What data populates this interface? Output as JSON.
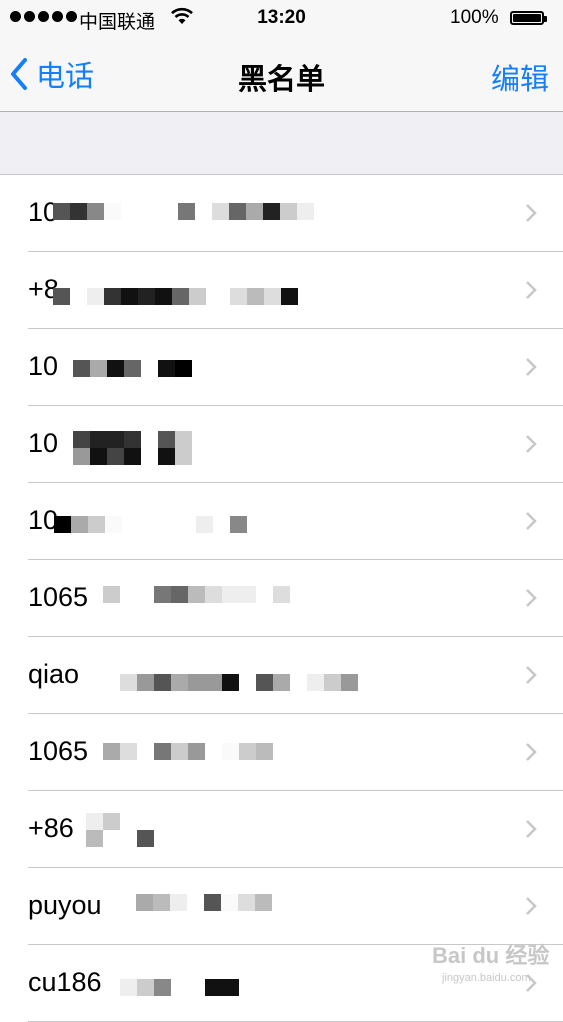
{
  "status_bar": {
    "carrier": "中国联通",
    "time": "13:20",
    "battery": "100%"
  },
  "nav": {
    "back_label": "电话",
    "title": "黑名单",
    "edit_label": "编辑"
  },
  "entries": [
    {
      "text": "10"
    },
    {
      "text": "+8"
    },
    {
      "text": "10"
    },
    {
      "text": "10"
    },
    {
      "text": "10"
    },
    {
      "text": "1065"
    },
    {
      "text": "qiao"
    },
    {
      "text": "1065"
    },
    {
      "text": "+86"
    },
    {
      "text": "puyou"
    },
    {
      "text": "cu186"
    }
  ],
  "watermark": {
    "brand": "Bai du 经验",
    "url": "jingyan.baidu.com"
  },
  "colors": {
    "accent": "#147efb",
    "separator": "#c8c7cc",
    "background": "#efeff4"
  }
}
